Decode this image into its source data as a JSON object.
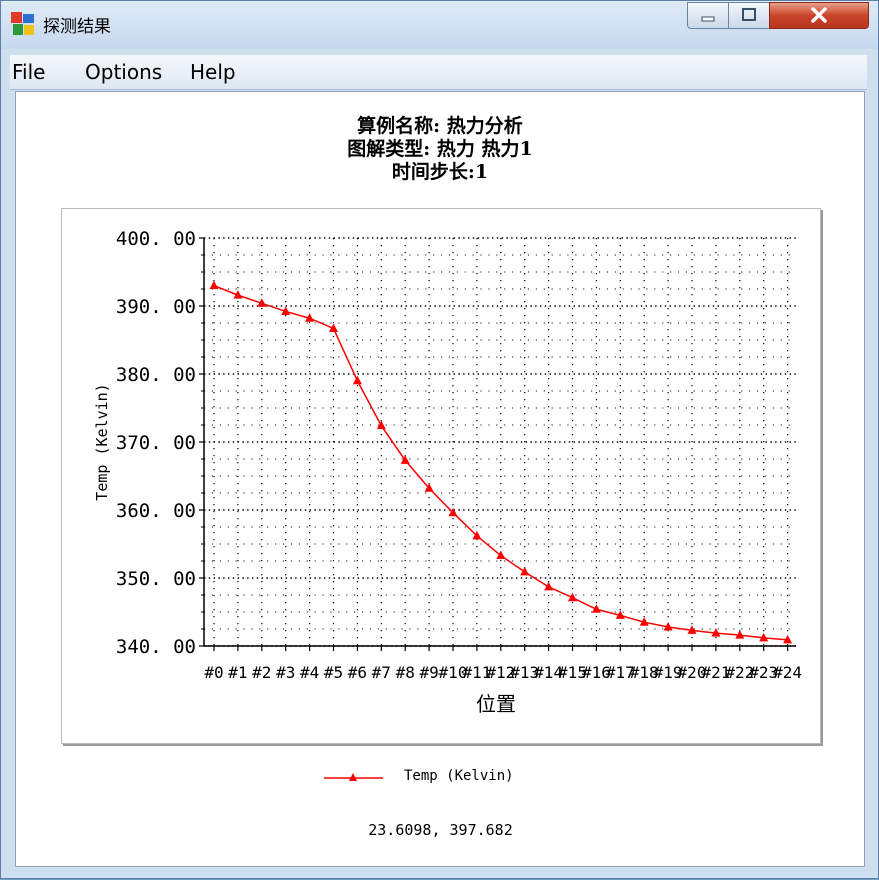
{
  "window": {
    "title": "探测结果",
    "controls": {
      "minimize": "minimize-icon",
      "maximize": "maximize-icon",
      "close": "close-icon"
    }
  },
  "menu": {
    "items": [
      "File",
      "Options",
      "Help"
    ]
  },
  "header": {
    "line1": "算例名称: 热力分析",
    "line2": "图解类型: 热力 热力1",
    "line3": "时间步长:1"
  },
  "colors": {
    "series": "#ff0000",
    "grid": "#000000"
  },
  "chart_data": {
    "type": "line",
    "xlabel": "位置",
    "ylabel": "Temp (Kelvin)",
    "ylim": [
      340,
      400
    ],
    "y_ticks": [
      "400. 00",
      "390. 00",
      "380. 00",
      "370. 00",
      "360. 00",
      "350. 00",
      "340. 00"
    ],
    "categories": [
      "#0",
      "#1",
      "#2",
      "#3",
      "#4",
      "#5",
      "#6",
      "#7",
      "#8",
      "#9",
      "#10",
      "#11",
      "#12",
      "#13",
      "#14",
      "#15",
      "#16",
      "#17",
      "#18",
      "#19",
      "#20",
      "#21",
      "#22",
      "#23",
      "#24"
    ],
    "series": [
      {
        "name": "Temp (Kelvin)",
        "values": [
          393.0,
          391.6,
          390.4,
          389.2,
          388.2,
          386.7,
          379.0,
          372.4,
          367.3,
          363.2,
          359.6,
          356.2,
          353.3,
          350.9,
          348.7,
          347.1,
          345.4,
          344.5,
          343.5,
          342.8,
          342.3,
          341.9,
          341.6,
          341.2,
          340.9
        ]
      }
    ],
    "grid": true,
    "legend_position": "bottom"
  },
  "status": {
    "coordinates": "23.6098, 397.682"
  }
}
